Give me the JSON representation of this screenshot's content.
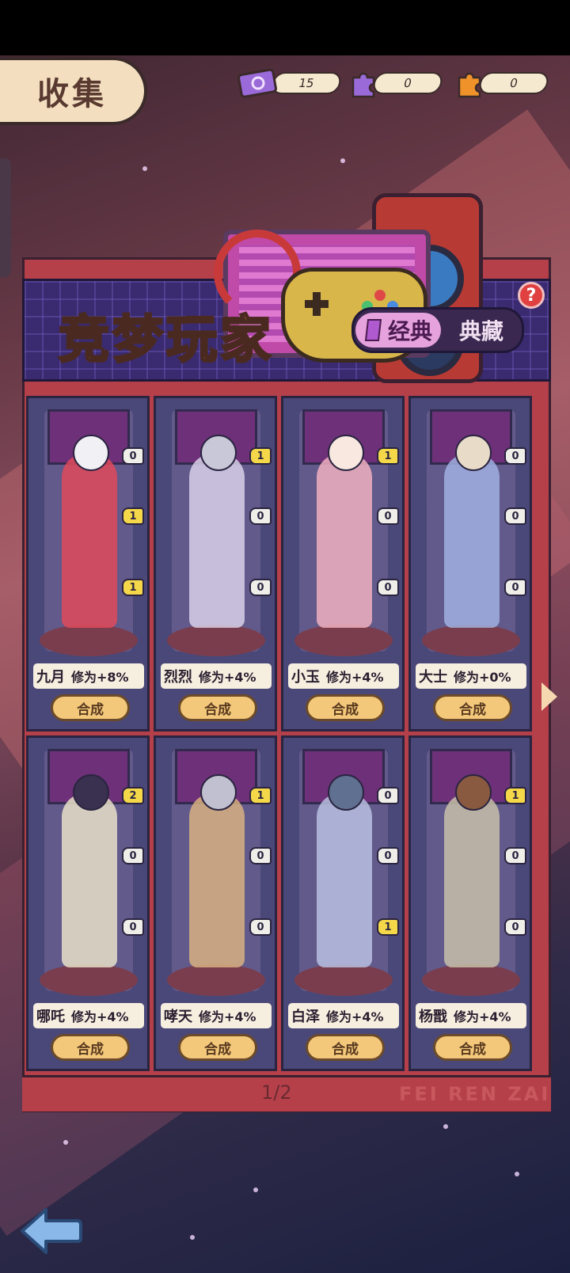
{
  "header": {
    "title": "收集"
  },
  "resources": [
    {
      "icon": "ticket-icon",
      "value": "15"
    },
    {
      "icon": "purple-puzzle-icon",
      "value": "0"
    },
    {
      "icon": "orange-puzzle-icon",
      "value": "0"
    }
  ],
  "banner": {
    "title": "竞梦玩家",
    "segments": [
      {
        "label": "经典",
        "selected": true
      },
      {
        "label": "典藏",
        "selected": false
      }
    ],
    "help_label": "?"
  },
  "characters": [
    {
      "name": "九月",
      "bonus": "修为+8%",
      "badges": [
        "0",
        "1",
        "1"
      ],
      "button": "合成"
    },
    {
      "name": "烈烈",
      "bonus": "修为+4%",
      "badges": [
        "1",
        "0",
        "0"
      ],
      "button": "合成"
    },
    {
      "name": "小玉",
      "bonus": "修为+4%",
      "badges": [
        "1",
        "0",
        "0"
      ],
      "button": "合成"
    },
    {
      "name": "大士",
      "bonus": "修为+0%",
      "badges": [
        "0",
        "0",
        "0"
      ],
      "button": "合成"
    },
    {
      "name": "哪吒",
      "bonus": "修为+4%",
      "badges": [
        "2",
        "0",
        "0"
      ],
      "button": "合成"
    },
    {
      "name": "哮天",
      "bonus": "修为+4%",
      "badges": [
        "1",
        "0",
        "0"
      ],
      "button": "合成"
    },
    {
      "name": "白泽",
      "bonus": "修为+4%",
      "badges": [
        "0",
        "0",
        "1"
      ],
      "button": "合成"
    },
    {
      "name": "杨戬",
      "bonus": "修为+4%",
      "badges": [
        "1",
        "0",
        "0"
      ],
      "button": "合成"
    }
  ],
  "pagination": {
    "page": "1/2"
  },
  "watermark": "FEI REN ZAI"
}
